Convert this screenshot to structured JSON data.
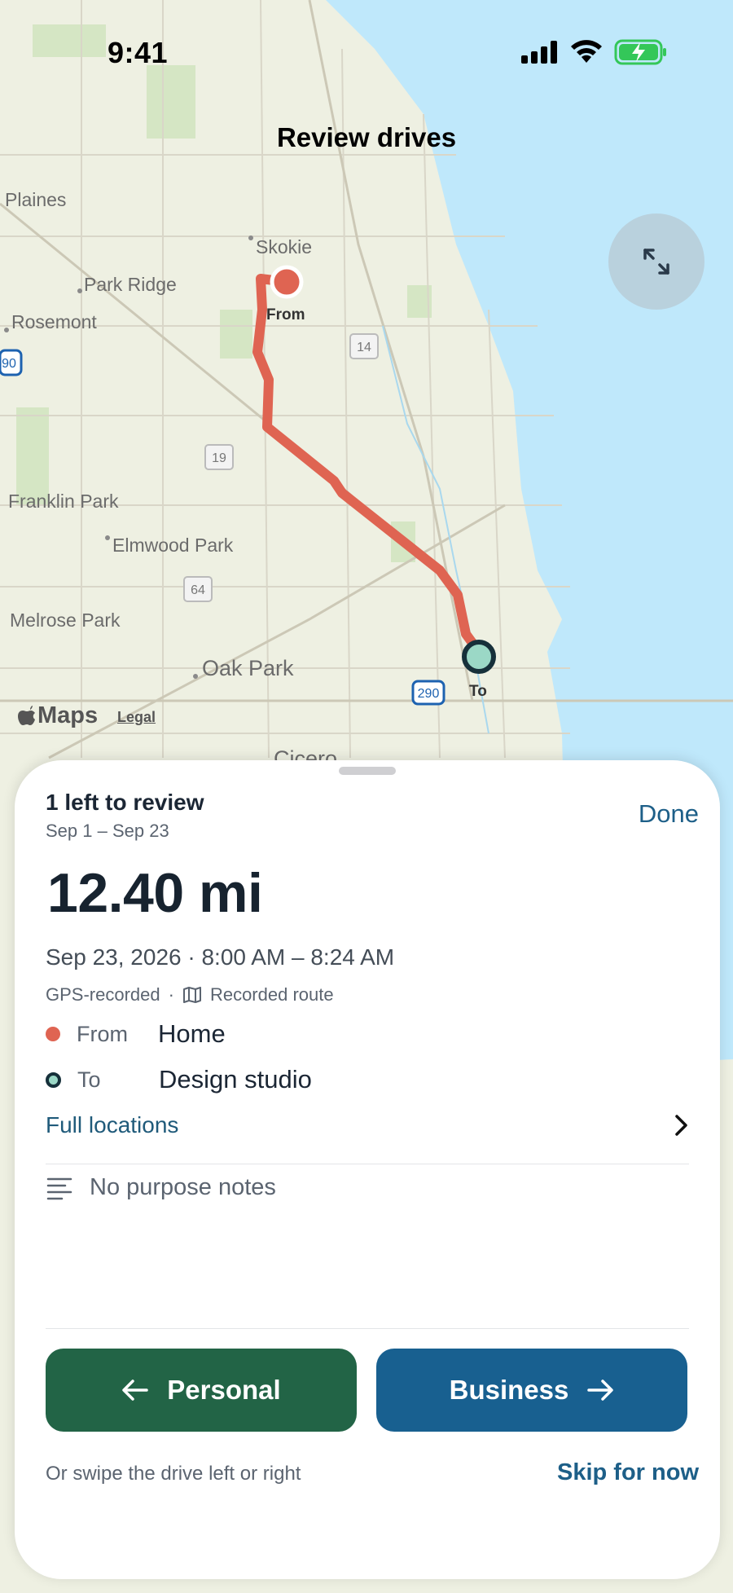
{
  "status_bar": {
    "time": "9:41",
    "icons": [
      "cellular-signal-icon",
      "wifi-icon",
      "battery-charging-icon"
    ]
  },
  "navigation": {
    "title": "Review drives",
    "expand_icon": "expand-arrows-icon"
  },
  "map": {
    "places": [
      {
        "name": "Plaines"
      },
      {
        "name": "Skokie"
      },
      {
        "name": "Park Ridge"
      },
      {
        "name": "Rosemont"
      },
      {
        "name": "Franklin Park"
      },
      {
        "name": "Elmwood Park"
      },
      {
        "name": "Melrose Park"
      },
      {
        "name": "Oak Park"
      },
      {
        "name": "Cicero"
      }
    ],
    "road_shields": [
      "14",
      "19",
      "64",
      "290",
      "90"
    ],
    "from_label": "From",
    "to_label": "To",
    "attribution": "Maps",
    "legal": "Legal",
    "colors": {
      "route": "#df6452",
      "water": "#bfe8fb",
      "land": "#eef0e2"
    }
  },
  "sheet": {
    "review_title": "1 left to review",
    "review_range": "Sep 1 – Sep 23",
    "done_label": "Done",
    "distance": "12.40 mi",
    "datetime": "Sep 23, 2026 · 8:00 AM – 8:24 AM",
    "meta": {
      "source": "GPS-recorded",
      "separator": "·",
      "route_label": "Recorded route",
      "route_icon": "map-icon"
    },
    "from": {
      "label": "From",
      "value": "Home",
      "color": "#df6452"
    },
    "to": {
      "label": "To",
      "value": "Design studio",
      "color": "#9bd8c6"
    },
    "full_locations_label": "Full locations",
    "notes_label": "No purpose notes",
    "personal_button": {
      "label": "Personal",
      "color": "#226446"
    },
    "business_button": {
      "label": "Business",
      "color": "#186090"
    },
    "swipe_hint": "Or swipe the drive left or right",
    "skip_label": "Skip for now"
  }
}
